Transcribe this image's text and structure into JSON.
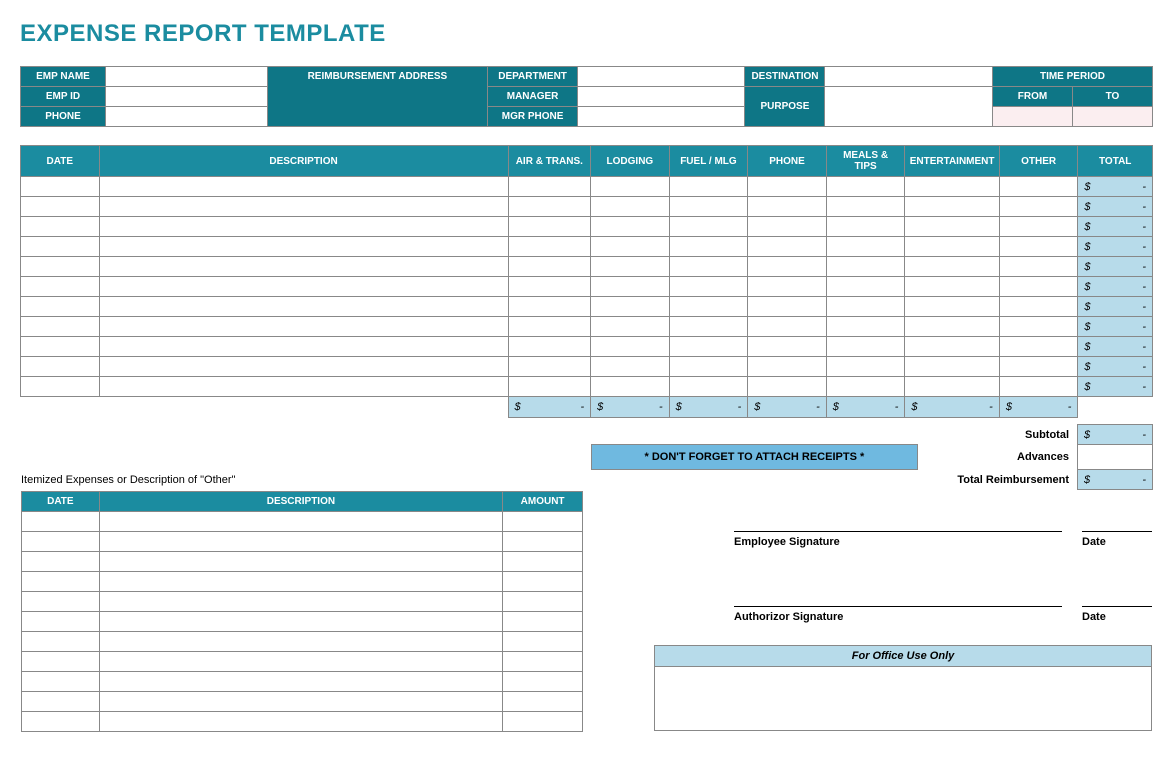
{
  "title": "EXPENSE REPORT TEMPLATE",
  "header": {
    "emp_name": "EMP NAME",
    "emp_id": "EMP ID",
    "phone": "PHONE",
    "reimb_addr": "REIMBURSEMENT ADDRESS",
    "department": "DEPARTMENT",
    "manager": "MANAGER",
    "mgr_phone": "MGR PHONE",
    "destination": "DESTINATION",
    "purpose": "PURPOSE",
    "time_period": "TIME PERIOD",
    "from": "FROM",
    "to": "TO"
  },
  "cols": {
    "date": "DATE",
    "desc": "DESCRIPTION",
    "air": "AIR & TRANS.",
    "lodging": "LODGING",
    "fuel": "FUEL / MLG",
    "phone": "PHONE",
    "meals": "MEALS & TIPS",
    "ent": "ENTERTAINMENT",
    "other": "OTHER",
    "total": "TOTAL"
  },
  "currency": "$",
  "dash": "-",
  "reminder": "* DON'T FORGET TO ATTACH RECEIPTS *",
  "summary": {
    "subtotal": "Subtotal",
    "advances": "Advances",
    "total_reimb": "Total Reimbursement"
  },
  "itemized": {
    "title": "Itemized Expenses or Description of \"Other\"",
    "date": "DATE",
    "desc": "DESCRIPTION",
    "amount": "AMOUNT"
  },
  "sig": {
    "emp": "Employee Signature",
    "auth": "Authorizor Signature",
    "date": "Date"
  },
  "office": "For Office Use Only"
}
